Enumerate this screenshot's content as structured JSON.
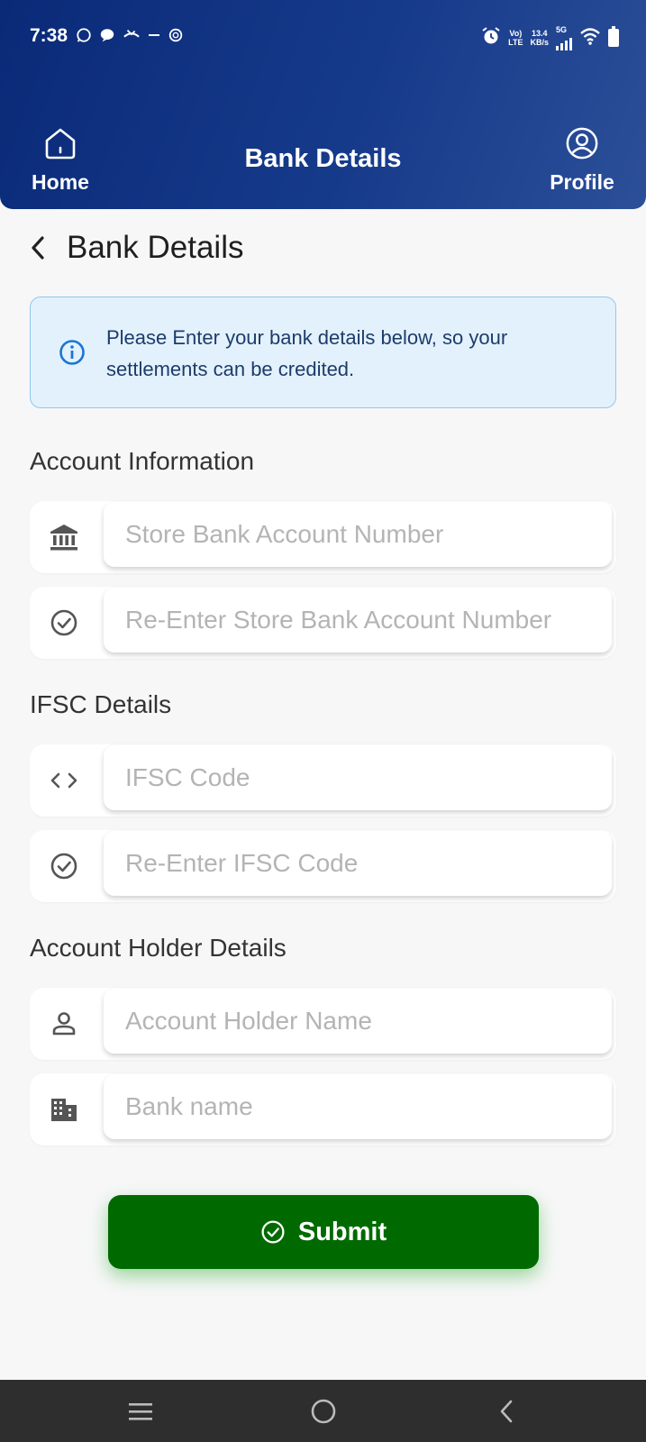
{
  "status_bar": {
    "time": "7:38",
    "network_top": "Vo)",
    "network_bottom": "LTE",
    "speed_value": "13.4",
    "speed_unit": "KB/s",
    "cell_gen": "5G",
    "left_icons": [
      "whatsapp-icon",
      "message-icon",
      "missed-call-icon",
      "dash-icon",
      "openai-icon"
    ],
    "right_icons": [
      "alarm-icon",
      "signal-icon",
      "wifi-icon",
      "battery-icon"
    ]
  },
  "header": {
    "title": "Bank Details",
    "home_label": "Home",
    "profile_label": "Profile"
  },
  "page": {
    "title": "Bank Details"
  },
  "info": {
    "text": "Please Enter your bank details below, so your settlements can be credited."
  },
  "sections": {
    "account_information": "Account Information",
    "ifsc_details": "IFSC Details",
    "account_holder_details": "Account Holder Details"
  },
  "fields": {
    "account_number": {
      "placeholder": "Store Bank Account Number",
      "value": ""
    },
    "account_number_confirm": {
      "placeholder": "Re-Enter Store Bank Account Number",
      "value": ""
    },
    "ifsc": {
      "placeholder": "IFSC Code",
      "value": ""
    },
    "ifsc_confirm": {
      "placeholder": "Re-Enter IFSC Code",
      "value": ""
    },
    "holder_name": {
      "placeholder": "Account Holder Name",
      "value": ""
    },
    "bank_name": {
      "placeholder": "Bank name",
      "value": ""
    }
  },
  "submit": {
    "label": "Submit"
  },
  "colors": {
    "header_gradient_start": "#0a2a78",
    "header_gradient_end": "#2c4f98",
    "submit_green": "#006a00",
    "info_bg": "#e3f1fc",
    "info_border": "#90c8ee",
    "info_text": "#1d3c6b",
    "info_icon": "#1976d2"
  }
}
